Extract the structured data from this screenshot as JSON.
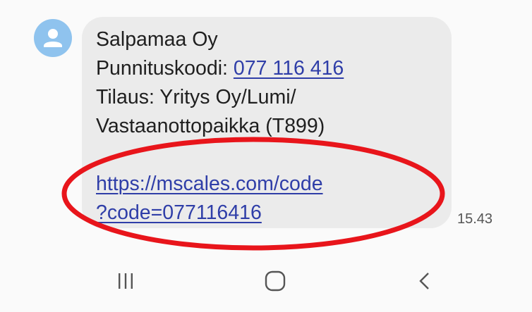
{
  "message": {
    "sender_line": "Salpamaa Oy",
    "code_label": "Punnituskoodi: ",
    "code_value": "077 116 416",
    "order_line1": "Tilaus: Yritys Oy/Lumi/",
    "order_line2": "Vastaanottopaikka (T899)",
    "link_line1": "https://mscales.com/code",
    "link_line2": "?code=077116416",
    "timestamp": "15.43"
  },
  "avatar": {
    "icon": "person-icon",
    "color": "#8fc3ee"
  },
  "annotation": {
    "shape": "ellipse",
    "color": "#e8151b"
  },
  "navbar": {
    "buttons": [
      {
        "name": "recent-apps",
        "icon": "recent-apps-icon"
      },
      {
        "name": "home",
        "icon": "home-icon"
      },
      {
        "name": "back",
        "icon": "back-icon"
      }
    ]
  },
  "colors": {
    "bubble": "#ebebeb",
    "link": "#2f3ea8",
    "text": "#1f1f1f",
    "background": "#fafafa"
  }
}
